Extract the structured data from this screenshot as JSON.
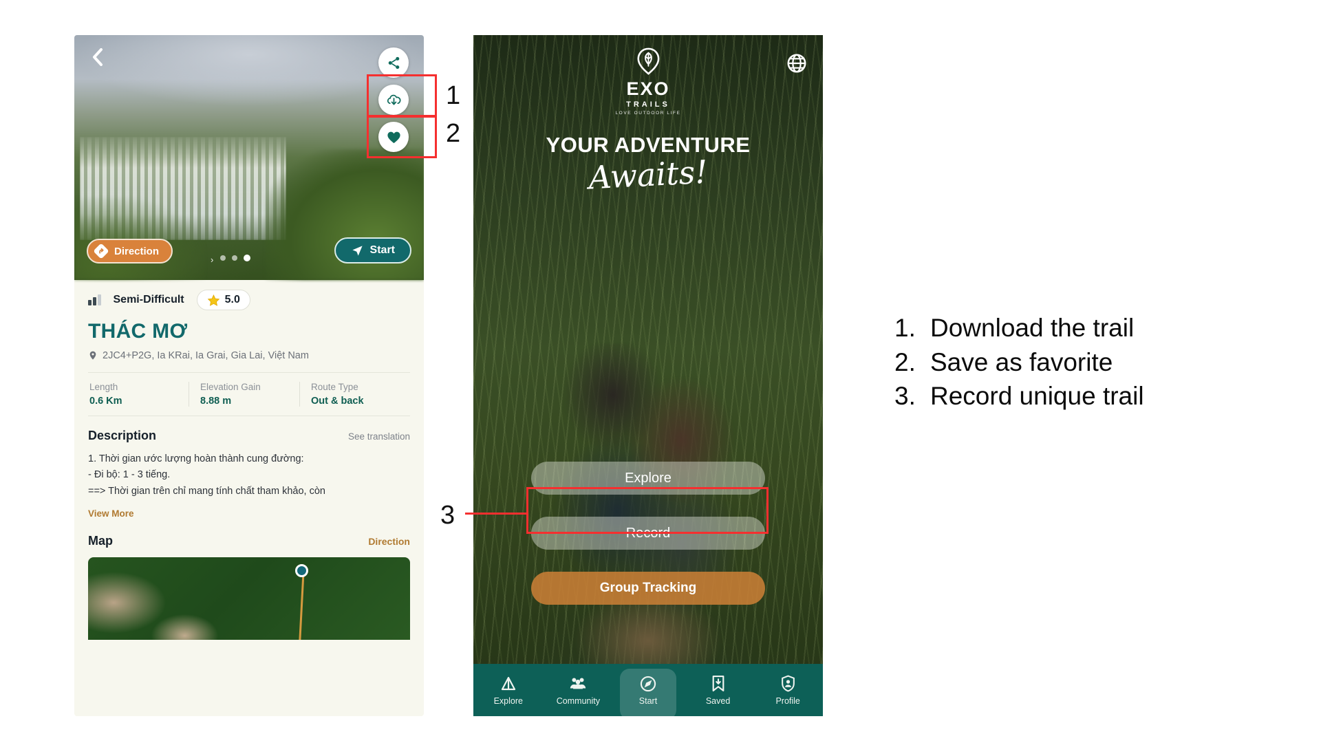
{
  "left_phone": {
    "back_icon": "chevron-left-icon",
    "actions": [
      {
        "icon": "share-icon",
        "name": "share"
      },
      {
        "icon": "cloud-download-icon",
        "name": "download"
      },
      {
        "icon": "heart-icon",
        "name": "favorite"
      }
    ],
    "direction_button": "Direction",
    "start_button": "Start",
    "carousel": {
      "dots": 3,
      "active_index": 2
    },
    "difficulty": "Semi-Difficult",
    "rating": "5.0",
    "title": "THÁC MƠ",
    "address": "2JC4+P2G, Ia KRai, Ia Grai, Gia Lai, Việt Nam",
    "stats": [
      {
        "label": "Length",
        "value": "0.6 Km"
      },
      {
        "label": "Elevation Gain",
        "value": "8.88 m"
      },
      {
        "label": "Route Type",
        "value": "Out & back"
      }
    ],
    "description_title": "Description",
    "see_translation": "See translation",
    "description_lines": [
      "1. Thời gian ước lượng hoàn thành cung đường:",
      "- Đi bộ: 1 - 3 tiếng.",
      "==> Thời gian trên chỉ mang tính chất tham khảo, còn"
    ],
    "view_more": "View More",
    "map_title": "Map",
    "map_direction": "Direction"
  },
  "right_phone": {
    "logo": {
      "name": "EXO",
      "sub": "TRAILS",
      "tagline": "LOVE OUTDOOR LIFE"
    },
    "globe_icon": "globe-icon",
    "headline": "YOUR ADVENTURE",
    "headline_script": "Awaits!",
    "actions": [
      {
        "label": "Explore",
        "name": "explore"
      },
      {
        "label": "Record",
        "name": "record"
      },
      {
        "label": "Group Tracking",
        "name": "group-tracking"
      }
    ],
    "tabs": [
      {
        "label": "Explore",
        "icon": "tent-icon",
        "active": false
      },
      {
        "label": "Community",
        "icon": "people-icon",
        "active": false
      },
      {
        "label": "Start",
        "icon": "compass-icon",
        "active": true
      },
      {
        "label": "Saved",
        "icon": "bookmark-icon",
        "active": false
      },
      {
        "label": "Profile",
        "icon": "shield-user-icon",
        "active": false
      }
    ]
  },
  "annotations": {
    "markers": [
      "1",
      "2",
      "3"
    ],
    "steps": [
      {
        "num": "1.",
        "text": "Download the trail"
      },
      {
        "num": "2.",
        "text": "Save as favorite"
      },
      {
        "num": "3.",
        "text": "Record unique trail"
      }
    ],
    "highlight_color": "#f52f2f"
  }
}
